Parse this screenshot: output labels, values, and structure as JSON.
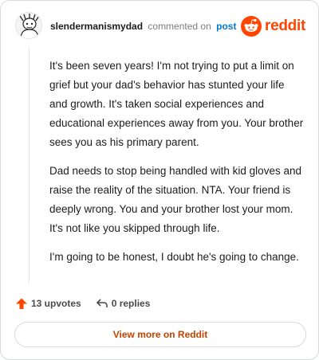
{
  "comment": {
    "author": "slendermanismydad",
    "action_text": "commented on",
    "post_link_label": "post",
    "paragraphs": [
      "It's been seven years! I'm not trying to put a limit on grief but your dad's behavior has stunted your life and growth. It's taken social experiences and educational experiences away from you. Your brother sees you as his primary parent.",
      "Dad needs to stop being handled with kid gloves and raise the reality of the situation. NTA. Your friend is deeply wrong. You and your brother lost your mom. It's not like you skipped through life.",
      "I'm going to be honest, I doubt he's going to change."
    ],
    "upvotes_label": "13 upvotes",
    "replies_label": "0 replies"
  },
  "brand": {
    "wordmark": "reddit",
    "color": "#ff4500"
  },
  "footer": {
    "view_more_label": "View more on Reddit",
    "link_color": "#c24300"
  },
  "icons": {
    "avatar": "snoo-avatar-icon",
    "logo": "reddit-snoo-icon",
    "upvote": "upvote-arrow-icon",
    "reply": "reply-arrow-icon"
  }
}
